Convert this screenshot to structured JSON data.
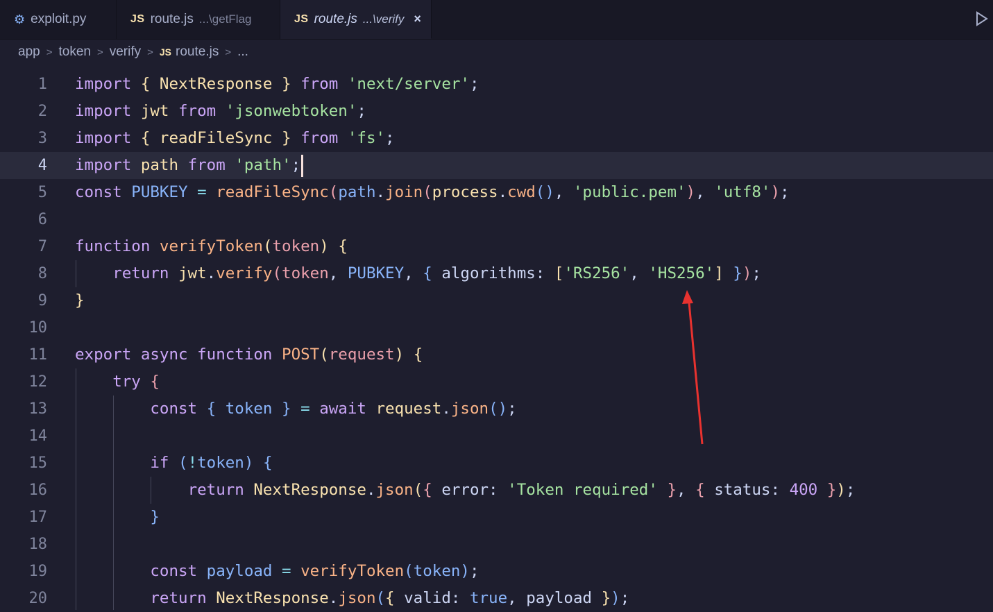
{
  "tabs": [
    {
      "icon": "python-icon",
      "name": "exploit.py",
      "desc": ""
    },
    {
      "icon": "javascript-icon",
      "icon_text": "JS",
      "name": "route.js",
      "desc": "...\\getFlag"
    },
    {
      "icon": "javascript-icon",
      "icon_text": "JS",
      "name": "route.js",
      "desc": "...\\verify",
      "close": "×"
    }
  ],
  "breadcrumb": [
    "app",
    "token",
    "verify",
    "route.js",
    "..."
  ],
  "breadcrumb_js_icon": "JS",
  "editor": {
    "current_line": 4,
    "line_numbers": [
      "1",
      "2",
      "3",
      "4",
      "5",
      "6",
      "7",
      "8",
      "9",
      "10",
      "11",
      "12",
      "13",
      "14",
      "15",
      "16",
      "17",
      "18",
      "19",
      "20"
    ]
  },
  "colors": {
    "background": "#1e1e2e",
    "keyword": "#cba6f7",
    "string": "#a6e3a1",
    "function": "#fab387",
    "arrow_annotation": "#e8322f"
  }
}
